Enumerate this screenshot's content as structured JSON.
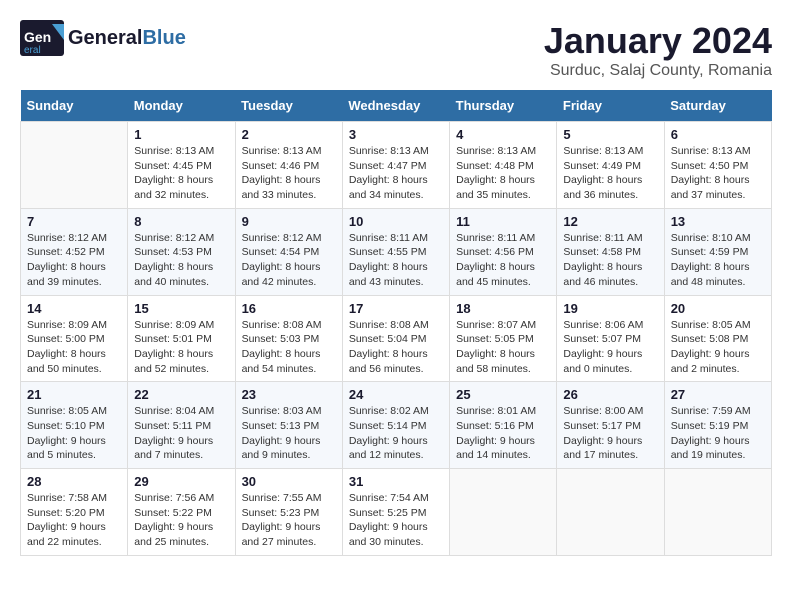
{
  "logo": {
    "general": "General",
    "blue": "Blue"
  },
  "header": {
    "month": "January 2024",
    "location": "Surduc, Salaj County, Romania"
  },
  "weekdays": [
    "Sunday",
    "Monday",
    "Tuesday",
    "Wednesday",
    "Thursday",
    "Friday",
    "Saturday"
  ],
  "weeks": [
    [
      {
        "day": "",
        "info": ""
      },
      {
        "day": "1",
        "info": "Sunrise: 8:13 AM\nSunset: 4:45 PM\nDaylight: 8 hours\nand 32 minutes."
      },
      {
        "day": "2",
        "info": "Sunrise: 8:13 AM\nSunset: 4:46 PM\nDaylight: 8 hours\nand 33 minutes."
      },
      {
        "day": "3",
        "info": "Sunrise: 8:13 AM\nSunset: 4:47 PM\nDaylight: 8 hours\nand 34 minutes."
      },
      {
        "day": "4",
        "info": "Sunrise: 8:13 AM\nSunset: 4:48 PM\nDaylight: 8 hours\nand 35 minutes."
      },
      {
        "day": "5",
        "info": "Sunrise: 8:13 AM\nSunset: 4:49 PM\nDaylight: 8 hours\nand 36 minutes."
      },
      {
        "day": "6",
        "info": "Sunrise: 8:13 AM\nSunset: 4:50 PM\nDaylight: 8 hours\nand 37 minutes."
      }
    ],
    [
      {
        "day": "7",
        "info": "Sunrise: 8:12 AM\nSunset: 4:52 PM\nDaylight: 8 hours\nand 39 minutes."
      },
      {
        "day": "8",
        "info": "Sunrise: 8:12 AM\nSunset: 4:53 PM\nDaylight: 8 hours\nand 40 minutes."
      },
      {
        "day": "9",
        "info": "Sunrise: 8:12 AM\nSunset: 4:54 PM\nDaylight: 8 hours\nand 42 minutes."
      },
      {
        "day": "10",
        "info": "Sunrise: 8:11 AM\nSunset: 4:55 PM\nDaylight: 8 hours\nand 43 minutes."
      },
      {
        "day": "11",
        "info": "Sunrise: 8:11 AM\nSunset: 4:56 PM\nDaylight: 8 hours\nand 45 minutes."
      },
      {
        "day": "12",
        "info": "Sunrise: 8:11 AM\nSunset: 4:58 PM\nDaylight: 8 hours\nand 46 minutes."
      },
      {
        "day": "13",
        "info": "Sunrise: 8:10 AM\nSunset: 4:59 PM\nDaylight: 8 hours\nand 48 minutes."
      }
    ],
    [
      {
        "day": "14",
        "info": "Sunrise: 8:09 AM\nSunset: 5:00 PM\nDaylight: 8 hours\nand 50 minutes."
      },
      {
        "day": "15",
        "info": "Sunrise: 8:09 AM\nSunset: 5:01 PM\nDaylight: 8 hours\nand 52 minutes."
      },
      {
        "day": "16",
        "info": "Sunrise: 8:08 AM\nSunset: 5:03 PM\nDaylight: 8 hours\nand 54 minutes."
      },
      {
        "day": "17",
        "info": "Sunrise: 8:08 AM\nSunset: 5:04 PM\nDaylight: 8 hours\nand 56 minutes."
      },
      {
        "day": "18",
        "info": "Sunrise: 8:07 AM\nSunset: 5:05 PM\nDaylight: 8 hours\nand 58 minutes."
      },
      {
        "day": "19",
        "info": "Sunrise: 8:06 AM\nSunset: 5:07 PM\nDaylight: 9 hours\nand 0 minutes."
      },
      {
        "day": "20",
        "info": "Sunrise: 8:05 AM\nSunset: 5:08 PM\nDaylight: 9 hours\nand 2 minutes."
      }
    ],
    [
      {
        "day": "21",
        "info": "Sunrise: 8:05 AM\nSunset: 5:10 PM\nDaylight: 9 hours\nand 5 minutes."
      },
      {
        "day": "22",
        "info": "Sunrise: 8:04 AM\nSunset: 5:11 PM\nDaylight: 9 hours\nand 7 minutes."
      },
      {
        "day": "23",
        "info": "Sunrise: 8:03 AM\nSunset: 5:13 PM\nDaylight: 9 hours\nand 9 minutes."
      },
      {
        "day": "24",
        "info": "Sunrise: 8:02 AM\nSunset: 5:14 PM\nDaylight: 9 hours\nand 12 minutes."
      },
      {
        "day": "25",
        "info": "Sunrise: 8:01 AM\nSunset: 5:16 PM\nDaylight: 9 hours\nand 14 minutes."
      },
      {
        "day": "26",
        "info": "Sunrise: 8:00 AM\nSunset: 5:17 PM\nDaylight: 9 hours\nand 17 minutes."
      },
      {
        "day": "27",
        "info": "Sunrise: 7:59 AM\nSunset: 5:19 PM\nDaylight: 9 hours\nand 19 minutes."
      }
    ],
    [
      {
        "day": "28",
        "info": "Sunrise: 7:58 AM\nSunset: 5:20 PM\nDaylight: 9 hours\nand 22 minutes."
      },
      {
        "day": "29",
        "info": "Sunrise: 7:56 AM\nSunset: 5:22 PM\nDaylight: 9 hours\nand 25 minutes."
      },
      {
        "day": "30",
        "info": "Sunrise: 7:55 AM\nSunset: 5:23 PM\nDaylight: 9 hours\nand 27 minutes."
      },
      {
        "day": "31",
        "info": "Sunrise: 7:54 AM\nSunset: 5:25 PM\nDaylight: 9 hours\nand 30 minutes."
      },
      {
        "day": "",
        "info": ""
      },
      {
        "day": "",
        "info": ""
      },
      {
        "day": "",
        "info": ""
      }
    ]
  ]
}
